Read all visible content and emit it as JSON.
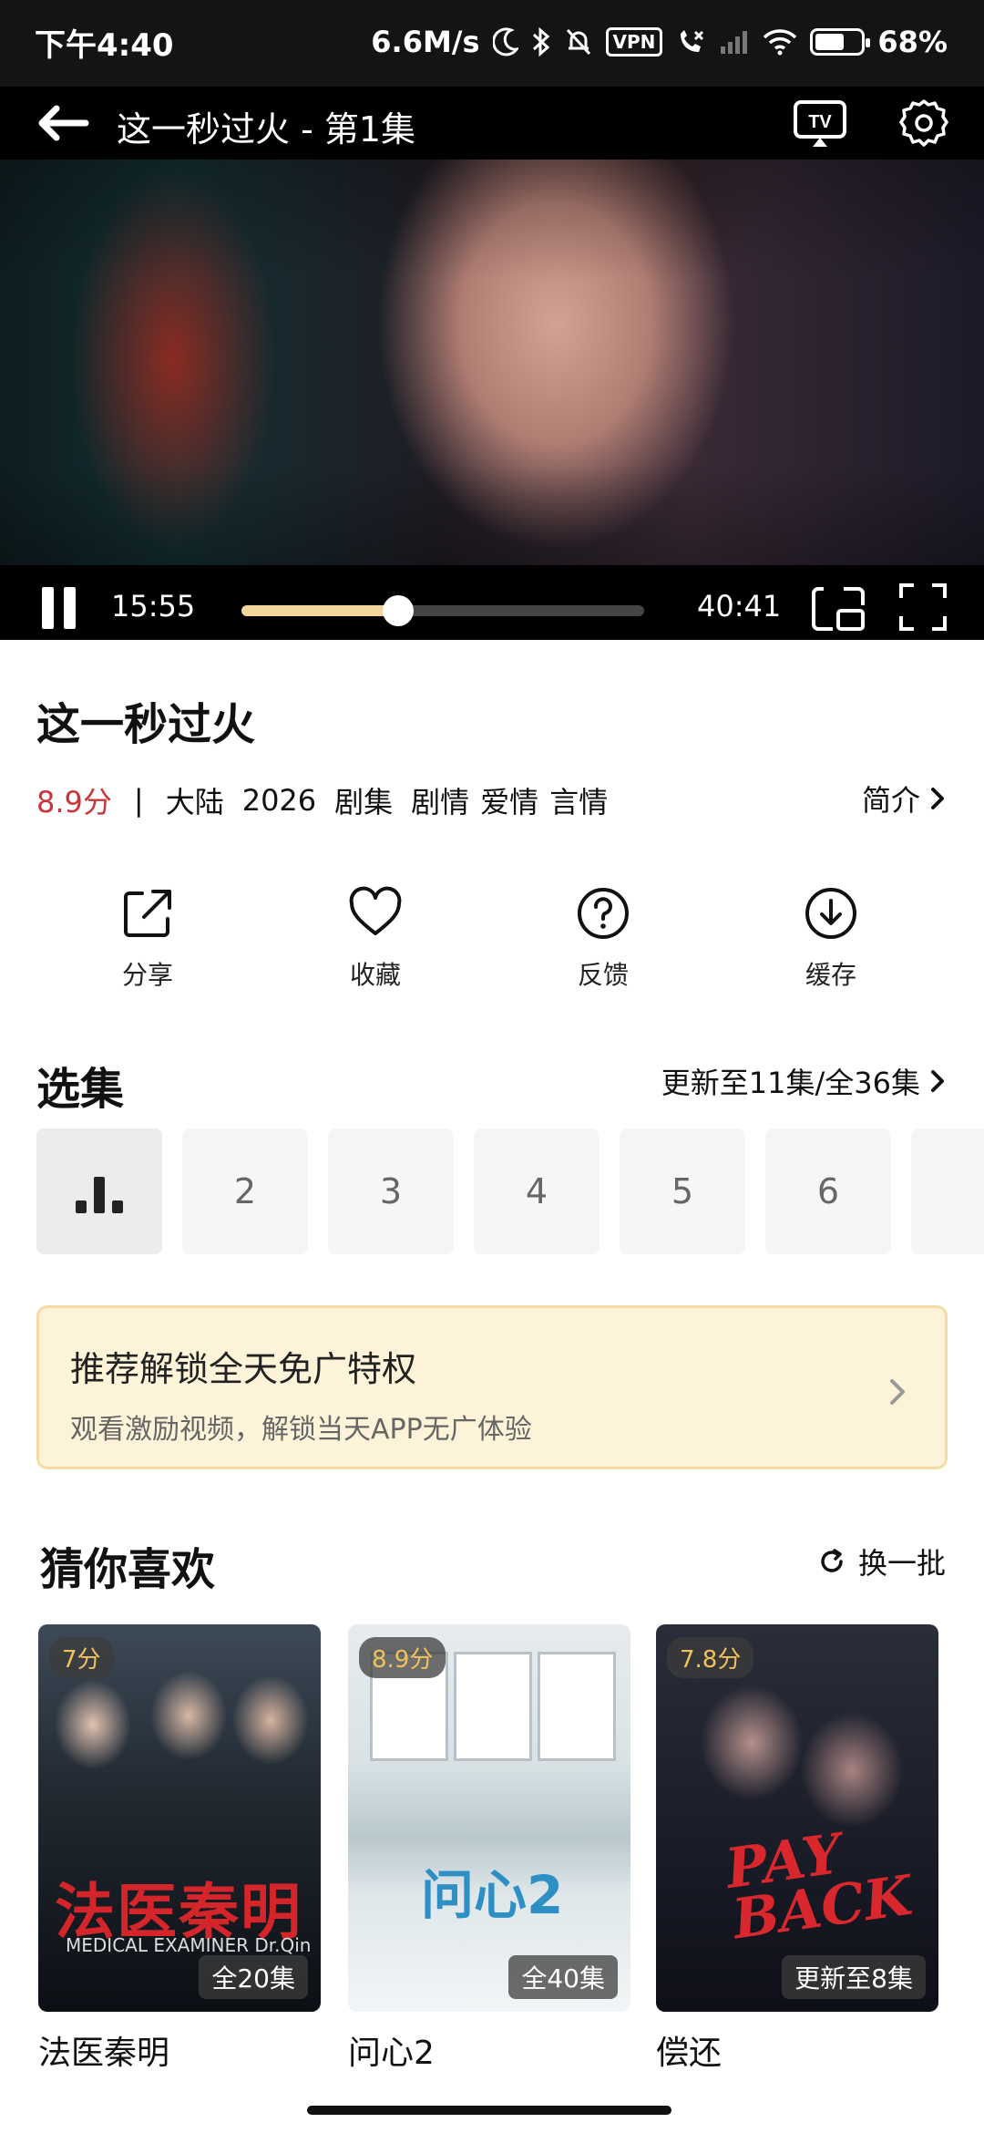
{
  "status_bar": {
    "time": "下午4:40",
    "speed": "6.6M/s",
    "vpn": "VPN",
    "battery": "68%",
    "battery_level": 0.68
  },
  "player": {
    "title": "这一秒过火 - 第1集",
    "current_time": "15:55",
    "total_time": "40:41",
    "progress": 0.39
  },
  "show": {
    "title": "这一秒过火",
    "score": "8.9分",
    "separator": "|",
    "tags": [
      "大陆",
      "2026",
      "剧集",
      "剧情",
      "爱情",
      "言情"
    ],
    "intro_label": "简介"
  },
  "actions": [
    {
      "label": "分享",
      "icon": "share-icon"
    },
    {
      "label": "收藏",
      "icon": "heart-icon"
    },
    {
      "label": "反馈",
      "icon": "question-icon"
    },
    {
      "label": "缓存",
      "icon": "download-icon"
    }
  ],
  "episodes": {
    "section_title": "选集",
    "update_info": "更新至11集/全36集",
    "items": [
      "1",
      "2",
      "3",
      "4",
      "5",
      "6"
    ],
    "playing_index": 0
  },
  "promo": {
    "title": "推荐解锁全天免广特权",
    "subtitle": "观看激励视频，解锁当天APP无广体验"
  },
  "recommend": {
    "section_title": "猜你喜欢",
    "refresh_label": "换一批",
    "items": [
      {
        "name": "法医秦明",
        "score": "7分",
        "episodes": "全20集",
        "poster_text": "法医秦明",
        "poster_sub": "MEDICAL EXAMINER Dr.Qin"
      },
      {
        "name": "问心2",
        "score": "8.9分",
        "episodes": "全40集",
        "poster_text": "问心2"
      },
      {
        "name": "偿还",
        "score": "7.8分",
        "episodes": "更新至8集",
        "poster_text": "PAY BACK"
      }
    ]
  },
  "colors": {
    "score_red": "#c9363a",
    "progress_fill": "#f3d49c",
    "promo_bg": "#fdf3d8",
    "poster_score": "#f1c15c"
  }
}
